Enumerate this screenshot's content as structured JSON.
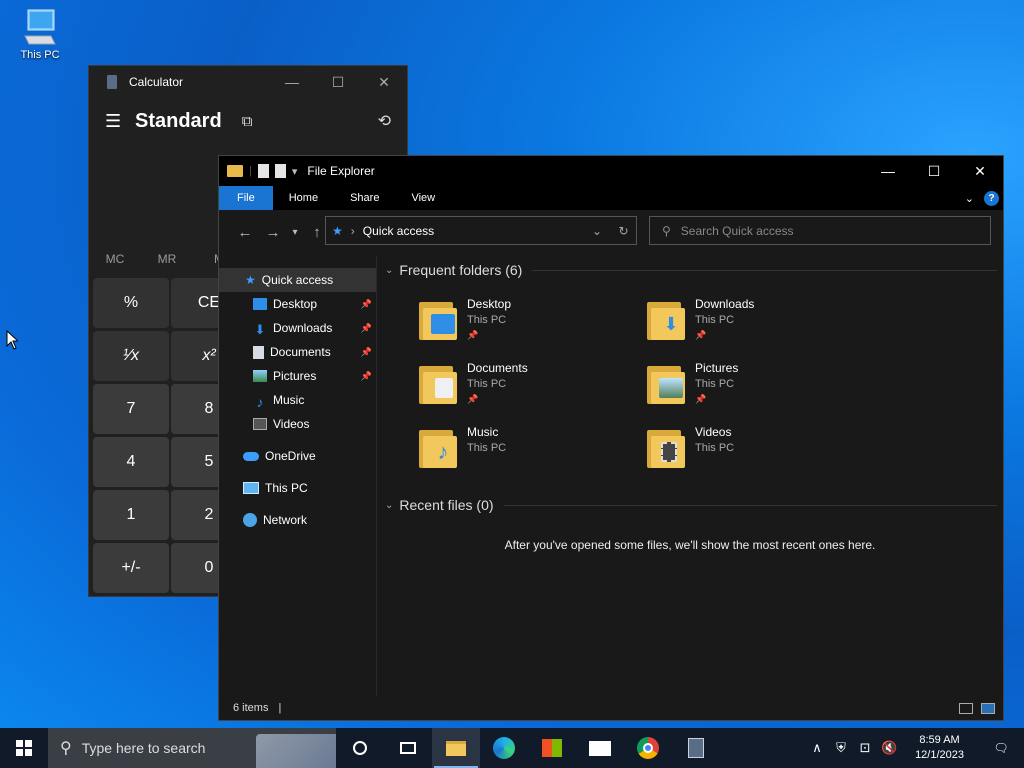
{
  "desktop": {
    "icons": [
      {
        "label": "This PC",
        "icon": "this-pc-icon"
      }
    ]
  },
  "calculator": {
    "title": "Calculator",
    "mode": "Standard",
    "memory": [
      "MC",
      "MR",
      "M"
    ],
    "buttons": [
      [
        "%",
        "CE"
      ],
      [
        "¹⁄x",
        "x²"
      ],
      [
        "7",
        "8"
      ],
      [
        "4",
        "5"
      ],
      [
        "1",
        "2"
      ],
      [
        "+/-",
        "0"
      ]
    ]
  },
  "explorer": {
    "title": "File Explorer",
    "ribbon_tabs": [
      "File",
      "Home",
      "Share",
      "View"
    ],
    "address": "Quick access",
    "search_placeholder": "Search Quick access",
    "nav": [
      {
        "label": "Quick access",
        "icon": "star-icon",
        "pinned": false,
        "selected": true
      },
      {
        "label": "Desktop",
        "icon": "desktop-icon",
        "pinned": true
      },
      {
        "label": "Downloads",
        "icon": "download-icon",
        "pinned": true
      },
      {
        "label": "Documents",
        "icon": "documents-icon",
        "pinned": true
      },
      {
        "label": "Pictures",
        "icon": "pictures-icon",
        "pinned": true
      },
      {
        "label": "Music",
        "icon": "music-icon",
        "pinned": false
      },
      {
        "label": "Videos",
        "icon": "videos-icon",
        "pinned": false
      },
      {
        "label": "OneDrive",
        "icon": "cloud-icon",
        "pinned": false
      },
      {
        "label": "This PC",
        "icon": "this-pc-icon",
        "pinned": false
      },
      {
        "label": "Network",
        "icon": "network-icon",
        "pinned": false
      }
    ],
    "frequent_header": "Frequent folders (6)",
    "folders": [
      {
        "name": "Desktop",
        "location": "This PC",
        "pinned": true
      },
      {
        "name": "Downloads",
        "location": "This PC",
        "pinned": true
      },
      {
        "name": "Documents",
        "location": "This PC",
        "pinned": true
      },
      {
        "name": "Pictures",
        "location": "This PC",
        "pinned": true
      },
      {
        "name": "Music",
        "location": "This PC",
        "pinned": false
      },
      {
        "name": "Videos",
        "location": "This PC",
        "pinned": false
      }
    ],
    "recent_header": "Recent files (0)",
    "recent_empty": "After you've opened some files, we'll show the most recent ones here.",
    "status": "6 items"
  },
  "taskbar": {
    "search_placeholder": "Type here to search",
    "time": "8:59 AM",
    "date": "12/1/2023",
    "apps": [
      "cortana-icon",
      "task-view-icon",
      "file-explorer-icon",
      "edge-icon",
      "store-icon",
      "mail-icon",
      "chrome-icon",
      "calculator-icon"
    ]
  },
  "colors": {
    "accent": "#1a74d2",
    "folder": "#f2c85c"
  }
}
